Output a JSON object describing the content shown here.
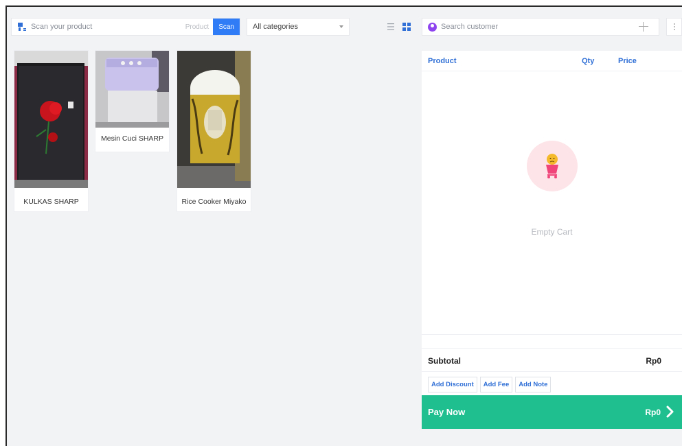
{
  "search": {
    "placeholder": "Scan your product",
    "mode_product": "Product",
    "mode_scan": "Scan"
  },
  "category_filter": {
    "selected": "All categories"
  },
  "products": [
    {
      "name": "KULKAS SHARP"
    },
    {
      "name": "Mesin Cuci SHARP"
    },
    {
      "name": "Rice Cooker Miyako"
    }
  ],
  "customer": {
    "placeholder": "Search customer"
  },
  "cart": {
    "columns": {
      "product": "Product",
      "qty": "Qty",
      "price": "Price"
    },
    "empty_text": "Empty Cart",
    "subtotal_label": "Subtotal",
    "subtotal_value": "Rp0",
    "actions": {
      "discount": "Add Discount",
      "fee": "Add Fee",
      "note": "Add Note"
    },
    "pay_label": "Pay Now",
    "pay_value": "Rp0"
  },
  "colors": {
    "accent": "#2f7cf6",
    "pay": "#20bf8f",
    "cart_header": "#2f6fd6"
  }
}
